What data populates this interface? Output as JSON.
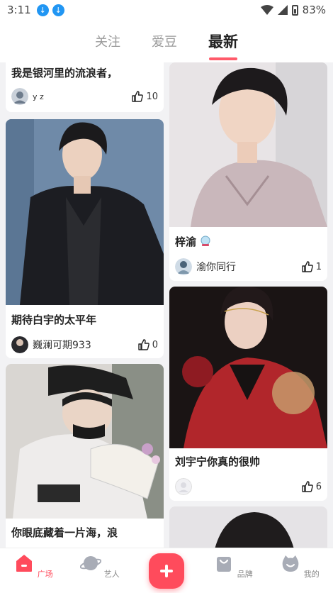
{
  "status_bar": {
    "time": "3:11",
    "battery": "83%",
    "download_icons": [
      "download-icon",
      "download-icon"
    ]
  },
  "tabs": [
    {
      "label": "关注",
      "active": false
    },
    {
      "label": "爱豆",
      "active": false
    },
    {
      "label": "最新",
      "active": true
    }
  ],
  "posts": [
    {
      "title": "我是银河里的流浪者，",
      "user": "y z",
      "likes": "10"
    },
    {
      "title": "梓渝",
      "user": "渝你同行",
      "likes": "1"
    },
    {
      "title": "期待白宇的太平年",
      "user": "巍澜可期933",
      "likes": "0"
    },
    {
      "title": "刘宇宁你真的很帅",
      "user": "",
      "likes": "6"
    },
    {
      "title": "你眼底藏着一片海，浪",
      "user": "",
      "likes": ""
    }
  ],
  "bottom_nav": [
    {
      "label": "广场",
      "active": true,
      "icon": "plaza-icon"
    },
    {
      "label": "艺人",
      "active": false,
      "icon": "planet-icon"
    },
    {
      "label": "",
      "active": false,
      "icon": "plus-icon"
    },
    {
      "label": "品牌",
      "active": false,
      "icon": "shopping-bag-icon"
    },
    {
      "label": "我的",
      "active": false,
      "icon": "profile-icon"
    }
  ],
  "colors": {
    "accent": "#ff4b5c",
    "tab_underline": "#ff5a6a",
    "background": "#f2f2f4"
  }
}
